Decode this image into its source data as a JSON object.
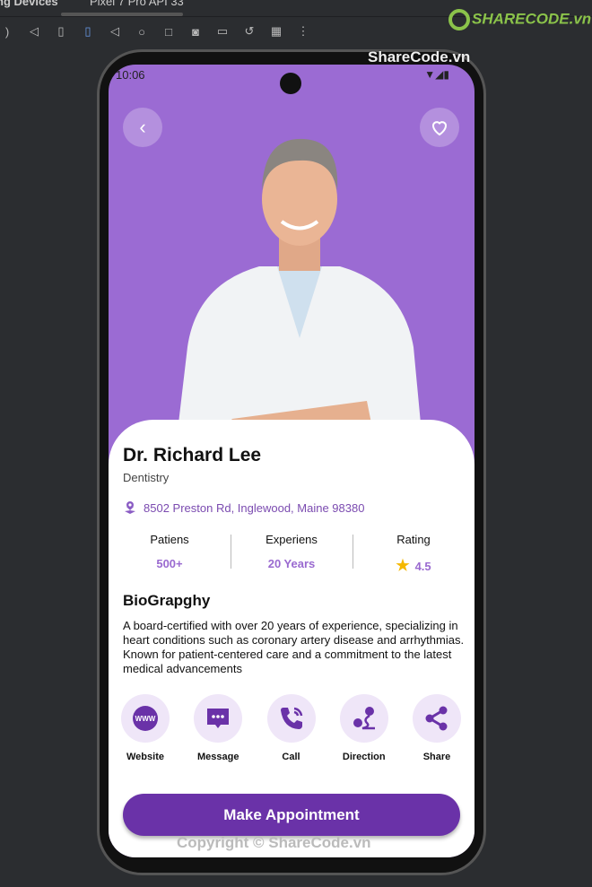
{
  "ide": {
    "panel_title": "ng Devices",
    "device_tab": "Pixel 7 Pro API 33"
  },
  "watermark": {
    "logo": "SHARECODE.vn",
    "top": "ShareCode.vn",
    "bottom": "Copyright © ShareCode.vn"
  },
  "status": {
    "time": "10:06"
  },
  "colors": {
    "primary": "#6a32a8",
    "header": "#9b6bd3",
    "accent_text": "#9a6ad0",
    "star": "#f5b800"
  },
  "doctor": {
    "name": "Dr. Richard Lee",
    "specialty": "Dentistry",
    "address": "8502 Preston Rd, Inglewood, Maine 98380"
  },
  "stats": [
    {
      "label": "Patiens",
      "value": "500+"
    },
    {
      "label": "Experiens",
      "value": "20 Years"
    },
    {
      "label": "Rating",
      "value": "4.5"
    }
  ],
  "bio": {
    "heading": "BioGrapghy",
    "text": "A board-certified with over 20 years of experience,  specializing in heart conditions such as coronary artery  disease and arrhythmias. Known for patient-centered care  and a commitment to the latest medical advancements"
  },
  "actions": [
    {
      "label": "Website",
      "icon": "www-globe-icon"
    },
    {
      "label": "Message",
      "icon": "message-icon"
    },
    {
      "label": "Call",
      "icon": "phone-icon"
    },
    {
      "label": "Direction",
      "icon": "direction-icon"
    },
    {
      "label": "Share",
      "icon": "share-icon"
    }
  ],
  "cta": {
    "label": "Make Appointment"
  }
}
